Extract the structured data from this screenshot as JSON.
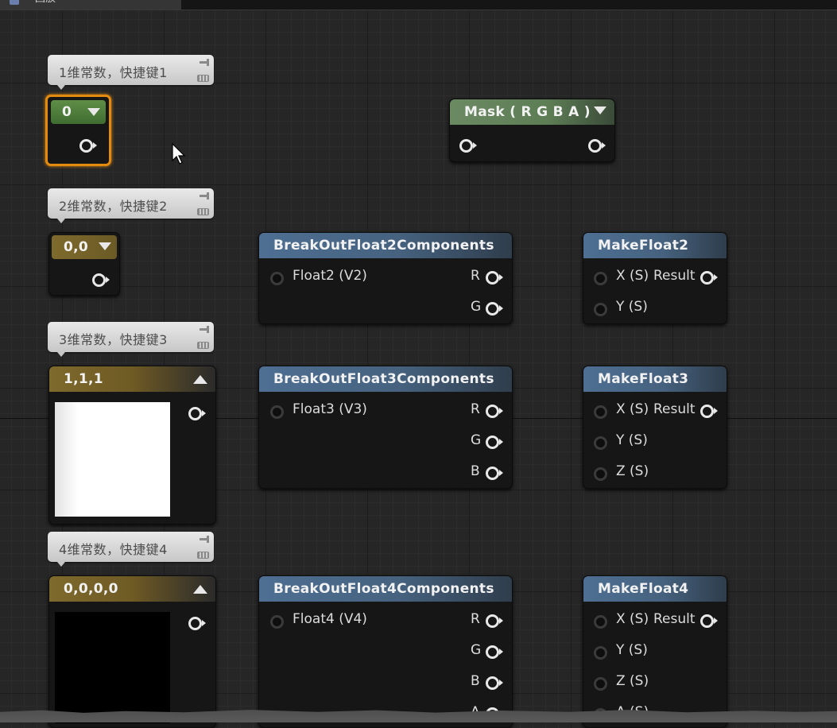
{
  "window": {
    "tab_title": "回放",
    "tab_icon": "blueprint-icon"
  },
  "comments": [
    {
      "text": "1维常数，快捷键1"
    },
    {
      "text": "2维常数，快捷键2"
    },
    {
      "text": "3维常数，快捷键3"
    },
    {
      "text": "4维常数，快捷键4"
    }
  ],
  "constants": {
    "c1": {
      "title": "0",
      "color": "#4a7b3a"
    },
    "c2": {
      "title": "0,0",
      "color": "#7e6a2c"
    },
    "c3": {
      "title": "1,1,1",
      "preview_color": "#ffffff"
    },
    "c4": {
      "title": "0,0,0,0",
      "preview_color": "#000000"
    }
  },
  "mask": {
    "title": "Mask ( R G B A )"
  },
  "break2": {
    "title": "BreakOutFloat2Components",
    "input": "Float2 (V2)",
    "outputs": [
      "R",
      "G"
    ]
  },
  "break3": {
    "title": "BreakOutFloat3Components",
    "input": "Float3 (V3)",
    "outputs": [
      "R",
      "G",
      "B"
    ]
  },
  "break4": {
    "title": "BreakOutFloat4Components",
    "input": "Float4 (V4)",
    "outputs": [
      "R",
      "G",
      "B",
      "A"
    ]
  },
  "make2": {
    "title": "MakeFloat2",
    "inputs": [
      "X (S)",
      "Y (S)"
    ],
    "output": "Result"
  },
  "make3": {
    "title": "MakeFloat3",
    "inputs": [
      "X (S)",
      "Y (S)",
      "Z (S)"
    ],
    "output": "Result"
  },
  "make4": {
    "title": "MakeFloat4",
    "inputs": [
      "X (S)",
      "Y (S)",
      "Z (S)",
      "A (S)"
    ],
    "output": "Result"
  },
  "colors": {
    "accent_selected": "#e38a10",
    "header_blue": "#4e6f93",
    "header_gold": "#7e6a2c",
    "header_green": "#4a7b3a"
  }
}
